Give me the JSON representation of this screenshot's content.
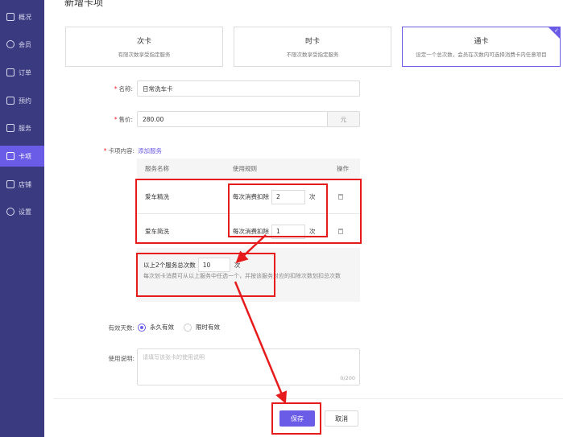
{
  "sidebar": {
    "items": [
      {
        "label": "概况",
        "icon": "overview-icon"
      },
      {
        "label": "会员",
        "icon": "member-icon"
      },
      {
        "label": "订单",
        "icon": "order-icon"
      },
      {
        "label": "预约",
        "icon": "appointment-icon"
      },
      {
        "label": "服务",
        "icon": "service-icon"
      },
      {
        "label": "卡项",
        "icon": "card-icon",
        "active": true
      },
      {
        "label": "店铺",
        "icon": "store-icon"
      },
      {
        "label": "设置",
        "icon": "settings-icon"
      }
    ]
  },
  "page": {
    "title": "新增卡项"
  },
  "card_types": [
    {
      "name": "次卡",
      "desc": "有限次数享受指定服务"
    },
    {
      "name": "时卡",
      "desc": "不限次数享受指定服务"
    },
    {
      "name": "通卡",
      "desc": "设定一个总次数，会员在次数内可选择消费卡内任意项目",
      "selected": true
    }
  ],
  "form": {
    "name_label": "名称:",
    "name_value": "日常洗车卡",
    "price_label": "售价:",
    "price_value": "280.00",
    "price_unit": "元",
    "content_label": "卡项内容:",
    "add_service": "添加服务",
    "validity_label": "有效天数:",
    "validity_options": [
      "永久有效",
      "限时有效"
    ],
    "desc_label": "使用说明:",
    "desc_placeholder": "请填写该张卡的使用说明",
    "desc_counter": "0/200"
  },
  "table": {
    "headers": [
      "服务名称",
      "使用规则",
      "操作"
    ],
    "rule_prefix": "每次消费扣除",
    "rule_unit": "次",
    "rows": [
      {
        "name": "爱车精洗",
        "deduct": "2"
      },
      {
        "name": "爱车简洗",
        "deduct": "1"
      }
    ],
    "total_prefix": "以上2个服务总次数",
    "total_value": "10",
    "total_unit": "次",
    "total_note": "每次划卡消费可从以上服务中任选一个，并按该服务对应的扣除次数划扣总次数"
  },
  "footer": {
    "save": "保存",
    "cancel": "取消"
  },
  "colors": {
    "sidebar": "#3a3a80",
    "accent": "#6b5ce7",
    "annotation": "#e61c1c"
  }
}
